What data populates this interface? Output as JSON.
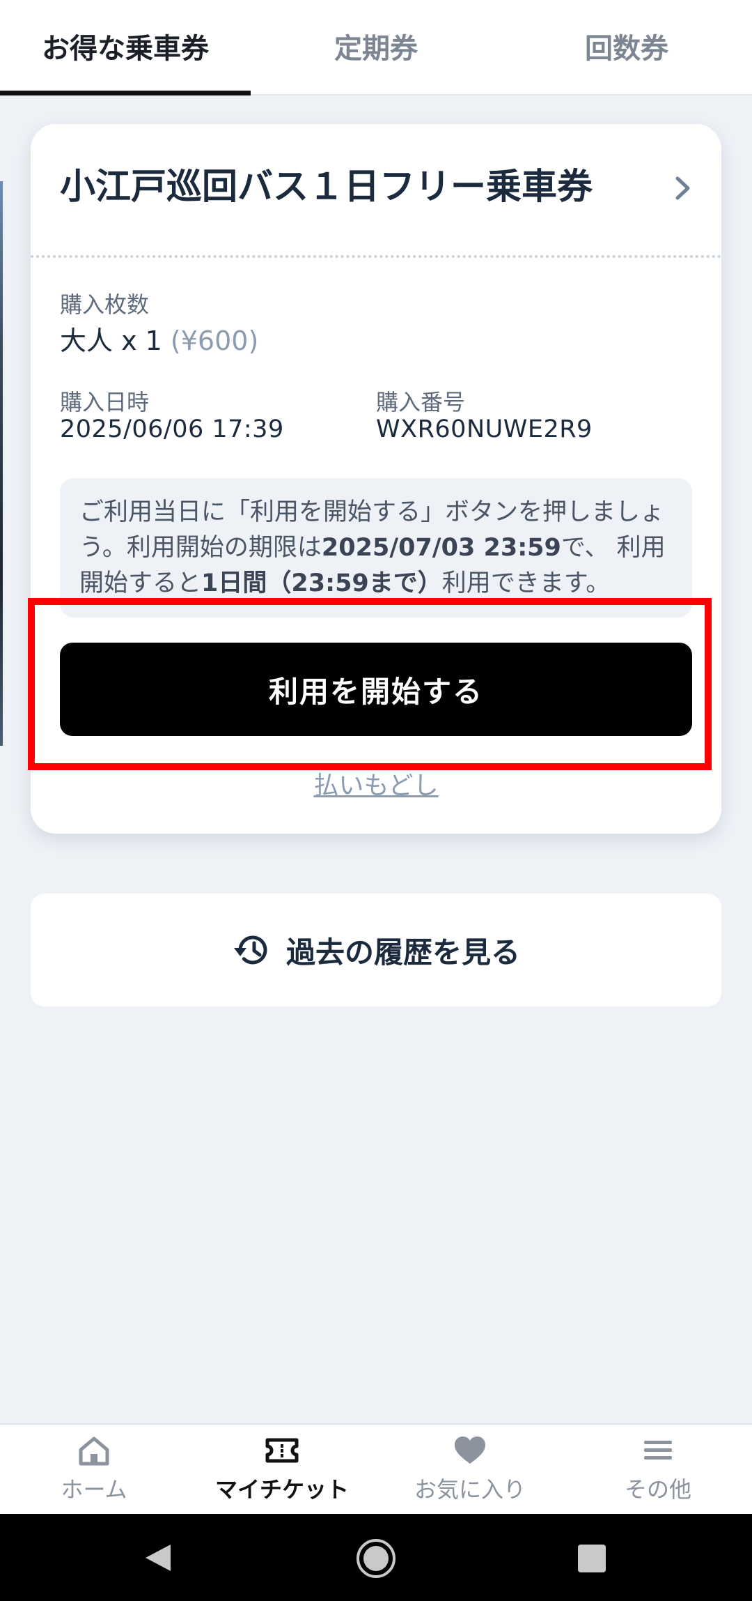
{
  "tabs": [
    {
      "label": "お得な乗車券",
      "active": true
    },
    {
      "label": "定期券",
      "active": false
    },
    {
      "label": "回数券",
      "active": false
    }
  ],
  "ticket": {
    "title": "小江戸巡回バス１日フリー乗車券",
    "quantity_label": "購入枚数",
    "quantity_value": "大人 x 1",
    "quantity_price": "(¥600)",
    "date_label": "購入日時",
    "date_value": "2025/06/06 17:39",
    "number_label": "購入番号",
    "number_value": "WXR60NUWE2R9",
    "notice": {
      "part1": "ご利用当日に「利用を開始する」ボタンを押しましょう。利用開始の期限は",
      "deadline": "2025/07/03 23:59",
      "part2": "で、 利用開始すると",
      "duration": "1日間（23:59まで）",
      "part3": "利用できます。"
    },
    "start_button": "利用を開始する",
    "refund_link": "払いもどし"
  },
  "history_button": "過去の履歴を見る",
  "bottom_nav": [
    {
      "label": "ホーム",
      "icon": "home-icon",
      "active": false
    },
    {
      "label": "マイチケット",
      "icon": "ticket-icon",
      "active": true
    },
    {
      "label": "お気に入り",
      "icon": "heart-icon",
      "active": false
    },
    {
      "label": "その他",
      "icon": "menu-icon",
      "active": false
    }
  ],
  "colors": {
    "accent": "#000000",
    "highlight": "#ff0000",
    "background": "#eef2f7"
  }
}
